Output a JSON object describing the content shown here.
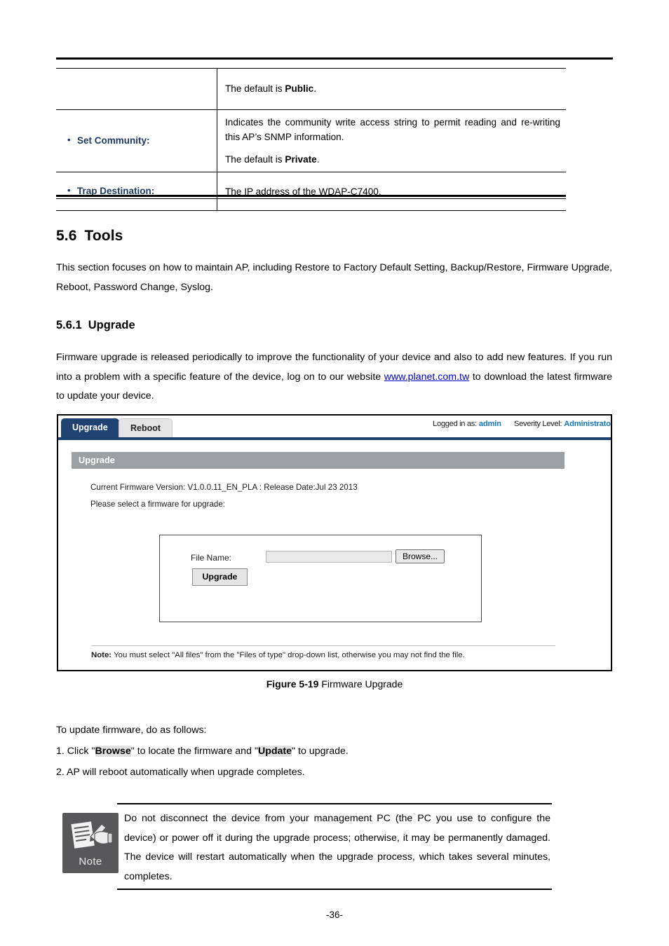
{
  "page": {
    "number": "-36-"
  },
  "param_table": {
    "rows": [
      {
        "label": "",
        "paragraphs": [
          {
            "pre": "The default is ",
            "bold": "Public",
            "post": "."
          }
        ]
      },
      {
        "label": "Set Community:",
        "paragraphs": [
          {
            "pre": "Indicates the community write access string to permit reading and re-writing this AP’s SNMP information.",
            "bold": "",
            "post": ""
          },
          {
            "pre": "The default is ",
            "bold": "Private",
            "post": "."
          }
        ]
      },
      {
        "label": "Trap Destination:",
        "paragraphs": [
          {
            "pre": "The IP address of the WDAP-C7400.",
            "bold": "",
            "post": ""
          }
        ]
      }
    ]
  },
  "section": {
    "number": "5.6",
    "title": "Tools",
    "intro": "This section focuses on how to maintain AP, including Restore to Factory Default Setting, Backup/Restore, Firmware Upgrade, Reboot, Password Change, Syslog."
  },
  "subsection": {
    "number": "5.6.1",
    "title": "Upgrade",
    "intro_pre": "Firmware upgrade is released periodically to improve the functionality of your device and also to add new features. If you run into a problem with a specific feature of the device, log on to our website ",
    "link": "www.planet.com.tw",
    "intro_post": " to download the latest firmware to update your device."
  },
  "figure_ui": {
    "tabs": [
      {
        "label": "Upgrade",
        "active": true
      },
      {
        "label": "Reboot",
        "active": false
      }
    ],
    "login_info": {
      "logged_in_label": "Logged in as:",
      "logged_in_value": "admin",
      "severity_label": "Severity Level:",
      "severity_value": "Administrator"
    },
    "panel_title": "Upgrade",
    "firmware_line": "Current Firmware Version: V1.0.0.11_EN_PLA :  Release Date:Jul 23 2013",
    "select_line": "Please select a firmware for upgrade:",
    "file_name_label": "File Name:",
    "file_name_value": "",
    "browse_button": "Browse...",
    "upgrade_button": "Upgrade",
    "note_label": "Note:",
    "note_text": " You must select \"All files\" from the \"Files of type\" drop-down list, otherwise you may not find the file.",
    "colors": {
      "active_tab": "#1f4273",
      "panel_bar": "#9da0a3",
      "link_value": "#1677c4"
    }
  },
  "caption": {
    "label": "Figure 5-19",
    "text": " Firmware Upgrade"
  },
  "instructions": {
    "lead": "To update firmware, do as follows:",
    "step1": {
      "a": "1. Click \"",
      "b1": "Browse",
      "c": "\" to locate the firmware and \"",
      "b2": "Update",
      "d": "\" to upgrade."
    },
    "step2": "2. AP will reboot automatically when upgrade completes."
  },
  "note_block": {
    "icon_caption": "Note",
    "text": "Do not disconnect the device from your management PC (the PC you use to configure the device) or power off it during the upgrade process; otherwise, it may be permanently damaged. The device will restart automatically when the upgrade process, which takes several minutes, completes."
  }
}
